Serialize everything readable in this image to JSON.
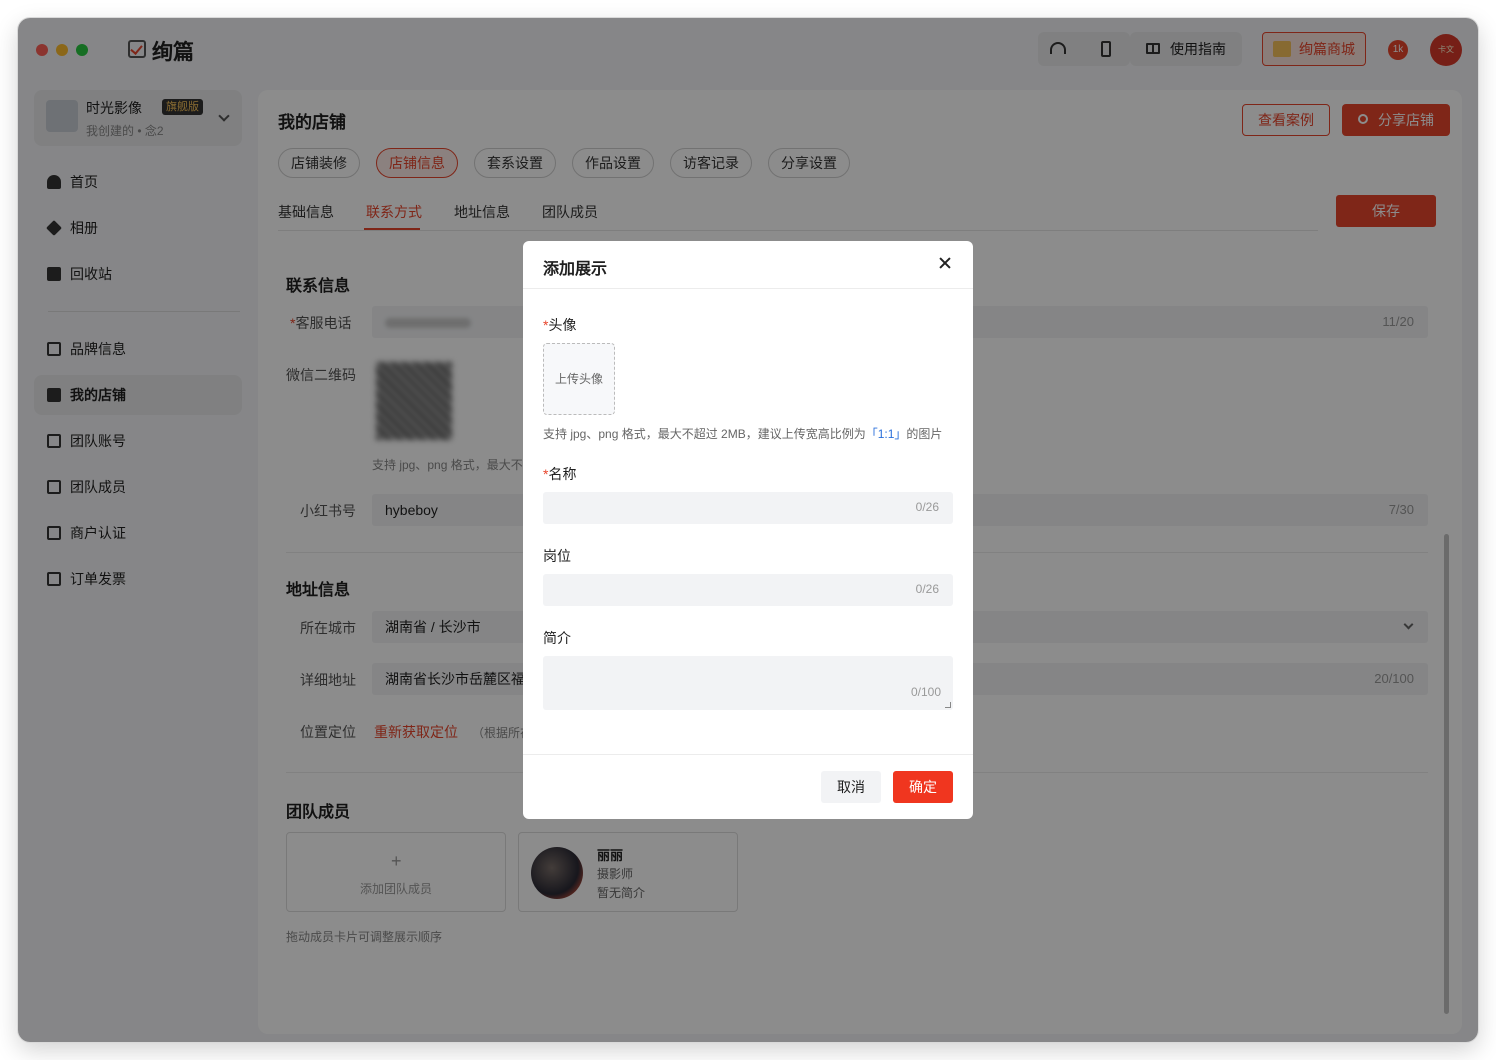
{
  "app": {
    "name": "绚篇"
  },
  "toolbar": {
    "guide_label": "使用指南",
    "mall_label": "绚篇商城",
    "notif_badge": "1k",
    "avatar_text": "卡文"
  },
  "workspace": {
    "name": "时光影像",
    "badge": "旗舰版",
    "sub": "我创建的 • 念2"
  },
  "sidebar": {
    "items": [
      {
        "label": "首页",
        "icon": "home-icon"
      },
      {
        "label": "相册",
        "icon": "layers-icon"
      },
      {
        "label": "回收站",
        "icon": "trash-icon"
      },
      {
        "label": "品牌信息",
        "icon": "diamond-icon"
      },
      {
        "label": "我的店铺",
        "icon": "store-icon",
        "active": true
      },
      {
        "label": "团队账号",
        "icon": "chart-icon"
      },
      {
        "label": "团队成员",
        "icon": "team-icon"
      },
      {
        "label": "商户认证",
        "icon": "document-icon"
      },
      {
        "label": "订单发票",
        "icon": "invoice-icon"
      }
    ]
  },
  "main": {
    "title": "我的店铺",
    "view_cases": "查看案例",
    "share_store": "分享店铺",
    "pills": [
      "店铺装修",
      "店铺信息",
      "套系设置",
      "作品设置",
      "访客记录",
      "分享设置"
    ],
    "active_pill": "店铺信息",
    "subtabs": [
      "基础信息",
      "联系方式",
      "地址信息",
      "团队成员"
    ],
    "active_subtab": "联系方式",
    "save": "保存",
    "contact": {
      "title": "联系信息",
      "phone_label": "客服电话",
      "phone_count": "11/20",
      "wechat_label": "微信二维码",
      "wechat_help": "支持 jpg、png 格式，最大不",
      "xhs_label": "小红书号",
      "xhs_value": "hybeboy",
      "xhs_count": "7/30"
    },
    "address": {
      "title": "地址信息",
      "city_label": "所在城市",
      "city_value": "湖南省 / 长沙市",
      "detail_label": "详细地址",
      "detail_value": "湖南省长沙市岳麓区福",
      "detail_count": "20/100",
      "locate_label": "位置定位",
      "relocate": "重新获取定位",
      "locate_hint": "（根据所在"
    },
    "team": {
      "title": "团队成员",
      "add_label": "添加团队成员",
      "member": {
        "name": "丽丽",
        "role": "摄影师",
        "bio": "暂无简介"
      },
      "drag_hint": "拖动成员卡片可调整展示顺序"
    }
  },
  "modal": {
    "title": "添加展示",
    "avatar_label": "头像",
    "upload_label": "上传头像",
    "upload_help_prefix": "支持 jpg、png 格式，最大不超过 2MB，建议上传宽高比例为",
    "upload_help_ratio": "「1:1」",
    "upload_help_suffix": "的图片",
    "name_label": "名称",
    "name_count": "0/26",
    "position_label": "岗位",
    "position_count": "0/26",
    "bio_label": "简介",
    "bio_count": "0/100",
    "cancel": "取消",
    "confirm": "确定"
  },
  "colors": {
    "accent": "#e8452c",
    "confirm": "#f0361f",
    "link": "#2a6fdb"
  }
}
